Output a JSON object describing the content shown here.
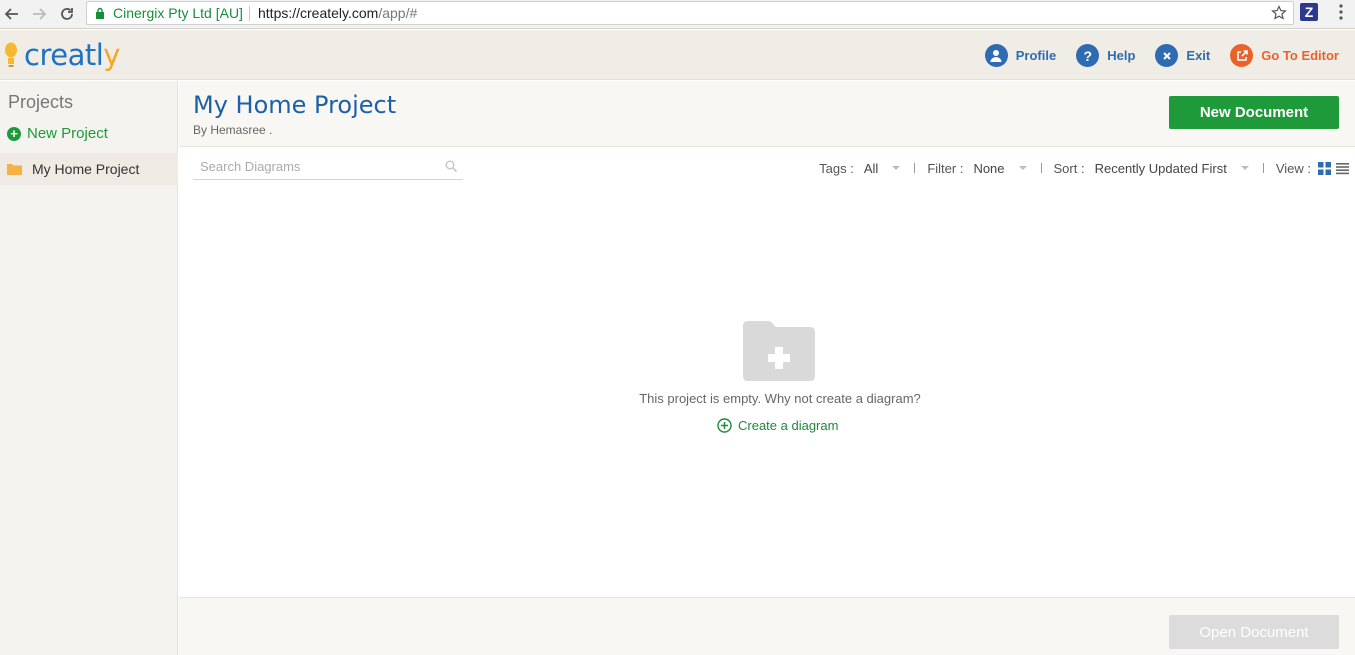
{
  "browser": {
    "site_identity": "Cinergix Pty Ltd [AU]",
    "url_main": "https://creately.com",
    "url_rest": "/app/#",
    "extension_letter": "Z"
  },
  "header": {
    "logo_text_main": "creatl",
    "logo_text_y": "y",
    "links": [
      {
        "label": "Profile",
        "icon": "person-icon"
      },
      {
        "label": "Help",
        "icon": "question-icon"
      },
      {
        "label": "Exit",
        "icon": "close-icon"
      },
      {
        "label": "Go To Editor",
        "icon": "external-link-icon"
      }
    ]
  },
  "sidebar": {
    "title": "Projects",
    "new_project": "New Project",
    "items": [
      {
        "label": "My Home Project",
        "selected": true
      }
    ]
  },
  "project": {
    "title": "My Home Project",
    "author": "By Hemasree .",
    "new_document": "New Document"
  },
  "search": {
    "placeholder": "Search Diagrams",
    "value": ""
  },
  "toolbar": {
    "tags_label": "Tags :",
    "tags_value": "All",
    "filter_label": "Filter :",
    "filter_value": "None",
    "sort_label": "Sort :",
    "sort_value": "Recently Updated First",
    "view_label": "View :"
  },
  "empty_state": {
    "message": "This project is empty. Why not create a diagram?",
    "create_link": "Create a diagram"
  },
  "footer": {
    "open_document": "Open Document"
  },
  "colors": {
    "brand_blue": "#1d72c4",
    "brand_green": "#1e9a3b",
    "accent_orange": "#e8622a"
  }
}
